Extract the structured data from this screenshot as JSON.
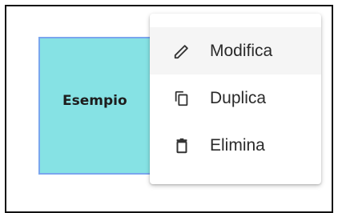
{
  "card": {
    "label": "Esempio",
    "background_color": "#86e2e4",
    "border_color": "#7aa6ee"
  },
  "context_menu": {
    "items": [
      {
        "label": "Modifica",
        "icon": "pencil-icon",
        "highlighted": true
      },
      {
        "label": "Duplica",
        "icon": "copy-icon",
        "highlighted": false
      },
      {
        "label": "Elimina",
        "icon": "trash-icon",
        "highlighted": false
      }
    ]
  }
}
